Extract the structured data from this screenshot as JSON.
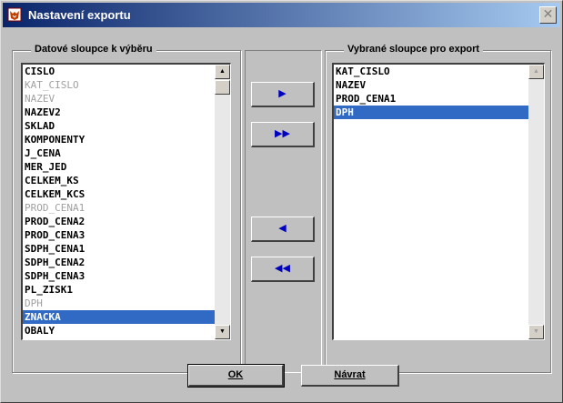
{
  "window": {
    "title": "Nastavení exportu",
    "close_symbol": "✕"
  },
  "left_group": {
    "title": "Datové sloupce k výběru",
    "items": [
      {
        "label": "CISLO",
        "state": "normal"
      },
      {
        "label": "KAT_CISLO",
        "state": "disabled"
      },
      {
        "label": "NAZEV",
        "state": "disabled"
      },
      {
        "label": "NAZEV2",
        "state": "normal"
      },
      {
        "label": "SKLAD",
        "state": "normal"
      },
      {
        "label": "KOMPONENTY",
        "state": "normal"
      },
      {
        "label": "J_CENA",
        "state": "normal"
      },
      {
        "label": "MER_JED",
        "state": "normal"
      },
      {
        "label": "CELKEM_KS",
        "state": "normal"
      },
      {
        "label": "CELKEM_KCS",
        "state": "normal"
      },
      {
        "label": "PROD_CENA1",
        "state": "disabled"
      },
      {
        "label": "PROD_CENA2",
        "state": "normal"
      },
      {
        "label": "PROD_CENA3",
        "state": "normal"
      },
      {
        "label": "SDPH_CENA1",
        "state": "normal"
      },
      {
        "label": "SDPH_CENA2",
        "state": "normal"
      },
      {
        "label": "SDPH_CENA3",
        "state": "normal"
      },
      {
        "label": "PL_ZISK1",
        "state": "normal"
      },
      {
        "label": "DPH",
        "state": "disabled"
      },
      {
        "label": "ZNACKA",
        "state": "selected"
      },
      {
        "label": "OBALY",
        "state": "normal"
      }
    ]
  },
  "right_group": {
    "title": "Vybrané sloupce pro export",
    "items": [
      {
        "label": "KAT_CISLO",
        "state": "normal"
      },
      {
        "label": "NAZEV",
        "state": "normal"
      },
      {
        "label": "PROD_CENA1",
        "state": "normal"
      },
      {
        "label": "DPH",
        "state": "selected"
      }
    ]
  },
  "move_buttons": {
    "add_one": "▶",
    "add_all": "▶▶",
    "remove_one": "◀",
    "remove_all": "◀◀"
  },
  "scroll_arrows": {
    "up": "▲",
    "down": "▼"
  },
  "buttons": {
    "ok": "OK",
    "back": "Návrat"
  },
  "colors": {
    "selection": "#316ac5",
    "titlebar_start": "#0a246a",
    "titlebar_end": "#a6caf0",
    "arrow": "#0000c0"
  }
}
